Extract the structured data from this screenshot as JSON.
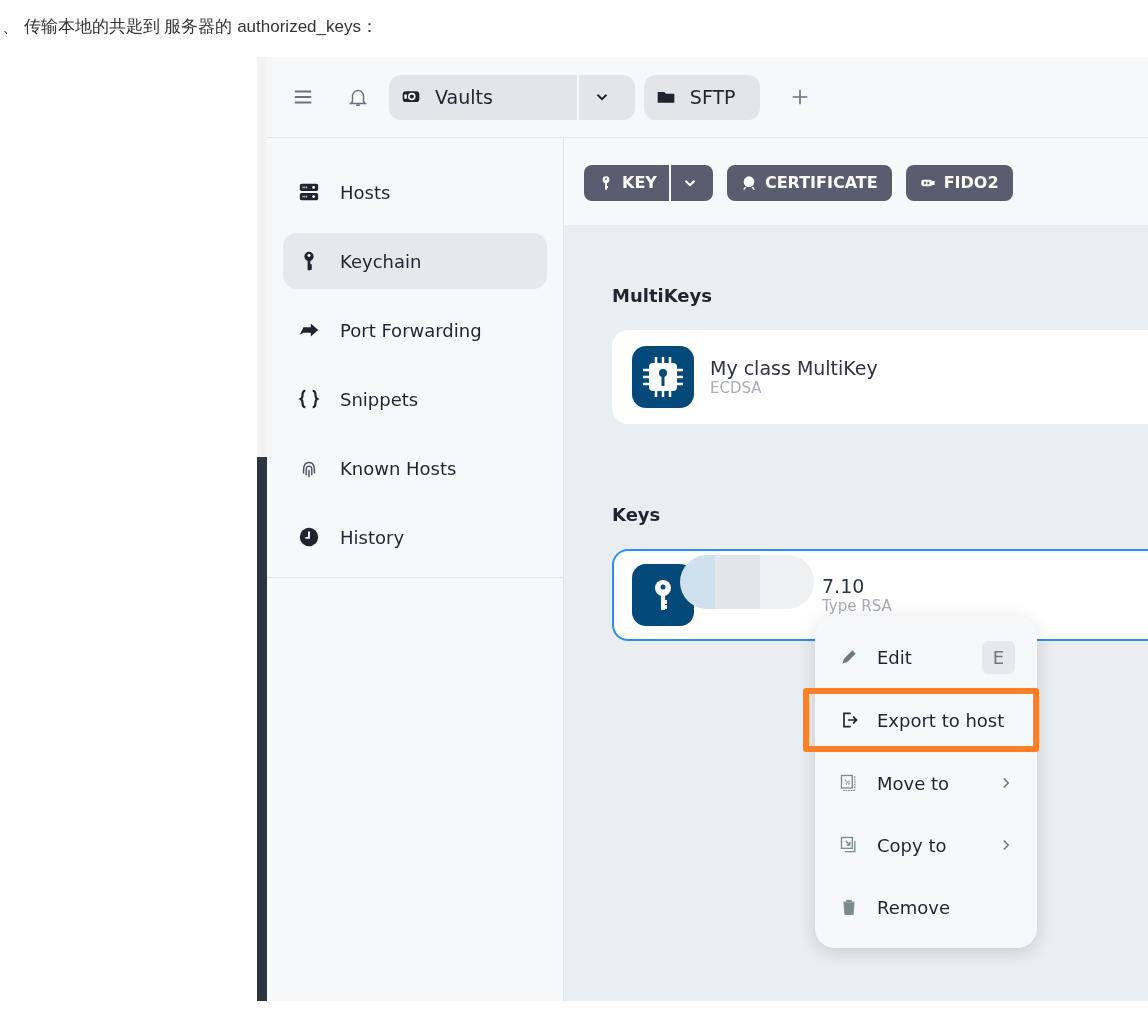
{
  "caption": "、 传输本地的共匙到 服务器的 authorized_keys：",
  "topbar": {
    "tabs": [
      {
        "label": "Vaults",
        "kind": "vault",
        "dropdown": true
      },
      {
        "label": "SFTP",
        "kind": "folder",
        "dropdown": false
      }
    ]
  },
  "sidebar": {
    "items": [
      {
        "label": "Hosts",
        "selected": false
      },
      {
        "label": "Keychain",
        "selected": true
      },
      {
        "label": "Port Forwarding",
        "selected": false
      },
      {
        "label": "Snippets",
        "selected": false
      },
      {
        "label": "Known Hosts",
        "selected": false
      },
      {
        "label": "History",
        "selected": false
      }
    ]
  },
  "toolbar": {
    "buttons": [
      {
        "label": "KEY",
        "dropdown": true
      },
      {
        "label": "CERTIFICATE",
        "dropdown": false
      },
      {
        "label": "FIDO2",
        "dropdown": false
      }
    ]
  },
  "sections": [
    {
      "title": "MultiKeys",
      "items": [
        {
          "name": "My class MultiKey",
          "detail": "ECDSA",
          "selected": false,
          "redacted": false
        }
      ]
    },
    {
      "title": "Keys",
      "items": [
        {
          "name": "7.10",
          "detail": "Type RSA",
          "selected": true,
          "redacted": true
        }
      ]
    }
  ],
  "context_menu": {
    "items": [
      {
        "label": "Edit",
        "shortcut": "E",
        "submenu": false,
        "annotated": false
      },
      {
        "label": "Export to host",
        "submenu": false,
        "annotated": true
      },
      {
        "label": "Move to",
        "submenu": true,
        "annotated": false
      },
      {
        "label": "Copy to",
        "submenu": true,
        "annotated": false
      },
      {
        "label": "Remove",
        "submenu": false,
        "annotated": false
      }
    ]
  }
}
